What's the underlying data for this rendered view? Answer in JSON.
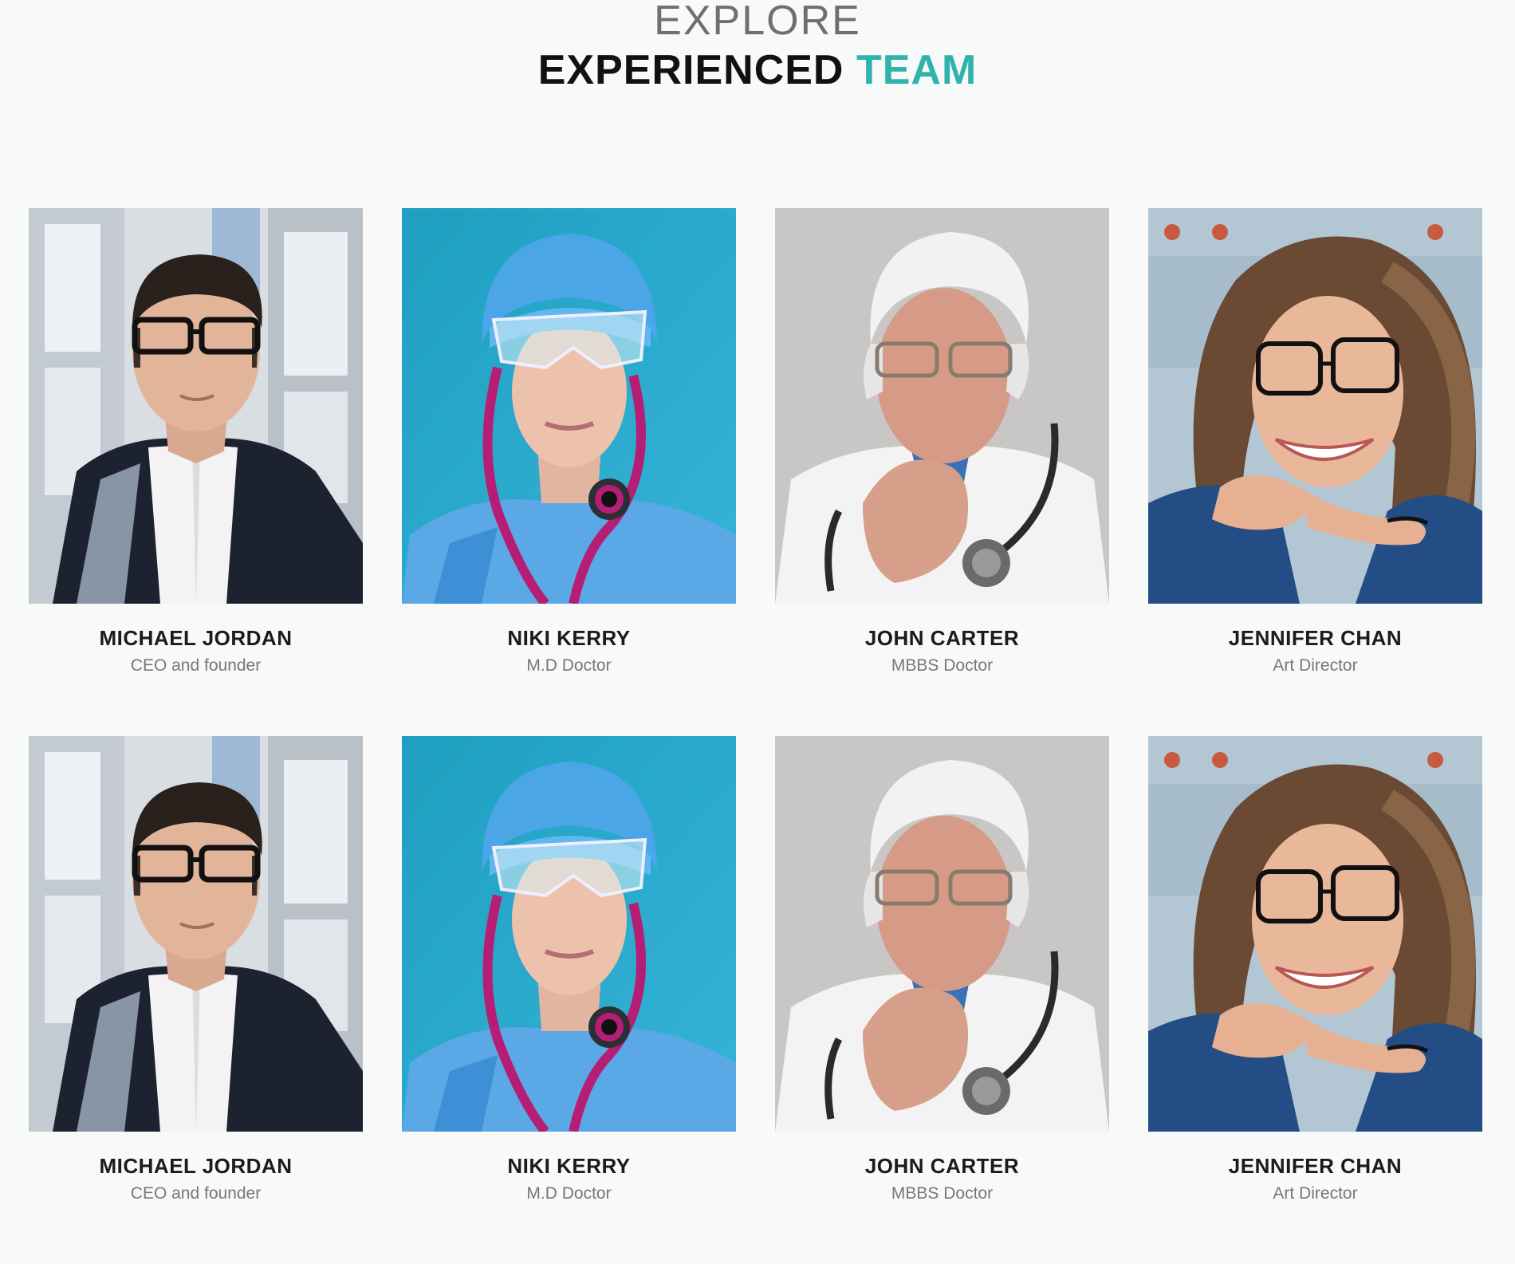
{
  "header": {
    "eyebrow": "EXPLORE",
    "title_main": "EXPERIENCED ",
    "title_accent": "TEAM"
  },
  "colors": {
    "accent": "#2fb3ad",
    "background": "#f8f9f9"
  },
  "team": [
    {
      "name": "MICHAEL JORDAN",
      "role": "CEO and founder",
      "photo_icon": "man-in-suit-photo"
    },
    {
      "name": "NIKI KERRY",
      "role": "M.D Doctor",
      "photo_icon": "surgeon-with-stethoscope-photo"
    },
    {
      "name": "JOHN CARTER",
      "role": "MBBS Doctor",
      "photo_icon": "senior-doctor-photo"
    },
    {
      "name": "JENNIFER CHAN",
      "role": "Art Director",
      "photo_icon": "smiling-woman-photo"
    },
    {
      "name": "MICHAEL JORDAN",
      "role": "CEO and founder",
      "photo_icon": "man-in-suit-photo"
    },
    {
      "name": "NIKI KERRY",
      "role": "M.D Doctor",
      "photo_icon": "surgeon-with-stethoscope-photo"
    },
    {
      "name": "JOHN CARTER",
      "role": "MBBS Doctor",
      "photo_icon": "senior-doctor-photo"
    },
    {
      "name": "JENNIFER CHAN",
      "role": "Art Director",
      "photo_icon": "smiling-woman-photo"
    }
  ]
}
